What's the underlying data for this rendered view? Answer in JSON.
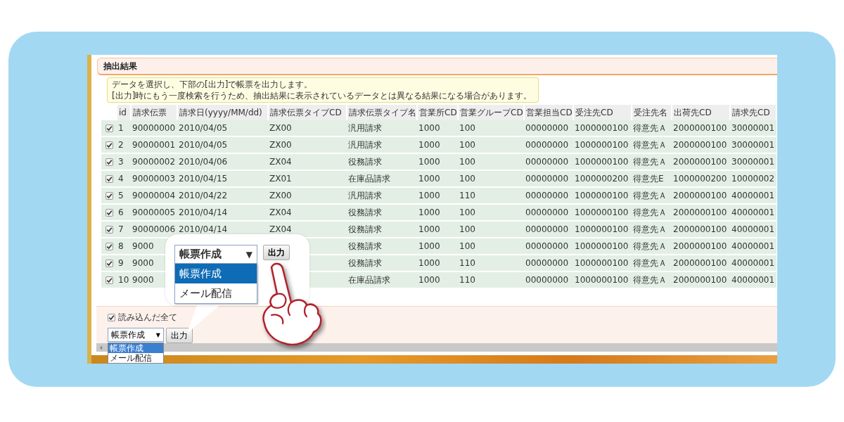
{
  "panel": {
    "title": "抽出結果"
  },
  "notice": [
    "データを選択し、下部の[出力]で帳票を出力します。",
    "[出力]時にもう一度検索を行うため、抽出結果に表示されているデータとは異なる結果になる場合があります。"
  ],
  "table": {
    "columns": [
      "id",
      "請求伝票",
      "請求日(yyyy/MM/dd)",
      "請求伝票タイプCD",
      "請求伝票タイプ名",
      "営業所CD",
      "営業グループCD",
      "営業担当CD",
      "受注先CD",
      "受注先名",
      "出荷先CD",
      "請求先CD"
    ],
    "rows": [
      {
        "checked": true,
        "cells": [
          "1",
          "90000000",
          "2010/04/05",
          "ZX00",
          "汎用請求",
          "1000",
          "100",
          "00000000",
          "1000000100",
          "得意先Ａ",
          "2000000100",
          "30000001"
        ]
      },
      {
        "checked": true,
        "cells": [
          "2",
          "90000001",
          "2010/04/05",
          "ZX00",
          "汎用請求",
          "1000",
          "100",
          "00000000",
          "1000000100",
          "得意先Ａ",
          "2000000100",
          "30000001"
        ]
      },
      {
        "checked": true,
        "cells": [
          "3",
          "90000002",
          "2010/04/06",
          "ZX04",
          "役務請求",
          "1000",
          "100",
          "00000000",
          "1000000100",
          "得意先Ａ",
          "2000000100",
          "30000001"
        ]
      },
      {
        "checked": true,
        "cells": [
          "4",
          "90000003",
          "2010/04/15",
          "ZX01",
          "在庫品請求",
          "1000",
          "100",
          "00000000",
          "1000000200",
          "得意先E",
          "1000000200",
          "10000002"
        ]
      },
      {
        "checked": true,
        "cells": [
          "5",
          "90000004",
          "2010/04/22",
          "ZX00",
          "汎用請求",
          "1000",
          "110",
          "00000000",
          "1000000100",
          "得意先Ａ",
          "2000000100",
          "40000001"
        ]
      },
      {
        "checked": true,
        "cells": [
          "6",
          "90000005",
          "2010/04/14",
          "ZX04",
          "役務請求",
          "1000",
          "100",
          "00000000",
          "1000000100",
          "得意先Ａ",
          "2000000100",
          "40000001"
        ]
      },
      {
        "checked": true,
        "cells": [
          "7",
          "90000006",
          "2010/04/14",
          "ZX04",
          "役務請求",
          "1000",
          "100",
          "00000000",
          "1000000100",
          "得意先Ａ",
          "2000000100",
          "40000001"
        ]
      },
      {
        "checked": true,
        "cells": [
          "8",
          "9000",
          null,
          null,
          "役務請求",
          "1000",
          "100",
          "00000000",
          "1000000100",
          "得意先Ａ",
          "2000000100",
          "40000001"
        ]
      },
      {
        "checked": true,
        "cells": [
          "9",
          "9000",
          null,
          null,
          "役務請求",
          "1000",
          "110",
          "00000000",
          "1000000100",
          "得意先Ａ",
          "2000000100",
          "40000001"
        ]
      },
      {
        "checked": true,
        "cells": [
          "10",
          "9000",
          null,
          null,
          "在庫品請求",
          "1000",
          "110",
          "00000000",
          "1000000100",
          "得意先Ａ",
          "2000000100",
          "40000001"
        ]
      }
    ]
  },
  "footer": {
    "select_all": {
      "label": "読み込んだ全て",
      "checked": true
    },
    "select": {
      "value": "帳票作成",
      "arrow": "▼",
      "options": [
        {
          "label": "帳票作成",
          "selected": true
        },
        {
          "label": "メール配信",
          "selected": false
        }
      ]
    },
    "button": "出力"
  },
  "callout": {
    "select": {
      "value": "帳票作成",
      "arrow": "▼",
      "options": [
        {
          "label": "帳票作成",
          "selected": true
        },
        {
          "label": "メール配信",
          "selected": false
        }
      ]
    },
    "button": "出力"
  }
}
